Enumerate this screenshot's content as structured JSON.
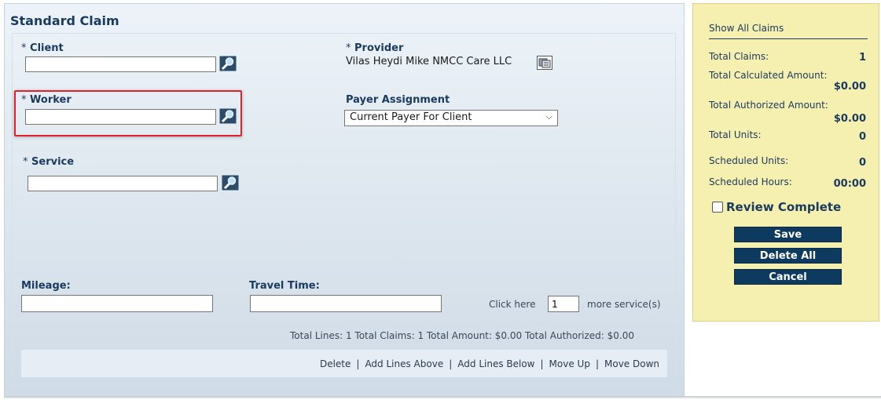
{
  "form": {
    "title": "Standard Claim",
    "client_label": "Client",
    "client_value": "",
    "provider_label": "Provider",
    "provider_value": "Vilas Heydi Mike NMCC Care LLC",
    "worker_label": "Worker",
    "worker_value": "",
    "payer_label": "Payer Assignment",
    "payer_selected": "Current Payer For Client",
    "service_label": "Service",
    "service_value": "",
    "required_marker": "*",
    "mileage_label": "Mileage:",
    "mileage_value": "",
    "travel_label": "Travel Time:",
    "travel_value": "",
    "click_here_label": "Click here",
    "more_count": "1",
    "more_label": "more service(s)",
    "totals_text": "Total Lines: 1 Total Claims: 1 Total Amount: $0.00 Total Authorized: $0.00"
  },
  "actions": {
    "delete": "Delete",
    "add_above": "Add Lines Above",
    "add_below": "Add Lines Below",
    "move_up": "Move Up",
    "move_down": "Move Down",
    "separator": "|"
  },
  "sidebar": {
    "show_all": "Show All Claims",
    "total_claims_label": "Total Claims:",
    "total_claims_value": "1",
    "total_calc_label": "Total Calculated Amount:",
    "total_calc_value": "$0.00",
    "total_auth_label": "Total Authorized Amount:",
    "total_auth_value": "$0.00",
    "total_units_label": "Total Units:",
    "total_units_value": "0",
    "sched_units_label": "Scheduled Units:",
    "sched_units_value": "0",
    "sched_hours_label": "Scheduled Hours:",
    "sched_hours_value": "00:00",
    "review_label": "Review Complete",
    "save": "Save",
    "delete_all": "Delete All",
    "cancel": "Cancel"
  },
  "colors": {
    "primary": "#0f3a5f",
    "sidebar_bg": "#f5efb0",
    "highlight": "#e0202a"
  },
  "icons": {
    "lookup": "magnifier-icon",
    "provider": "provider-card-icon",
    "dropdown": "chevron-down-icon"
  }
}
